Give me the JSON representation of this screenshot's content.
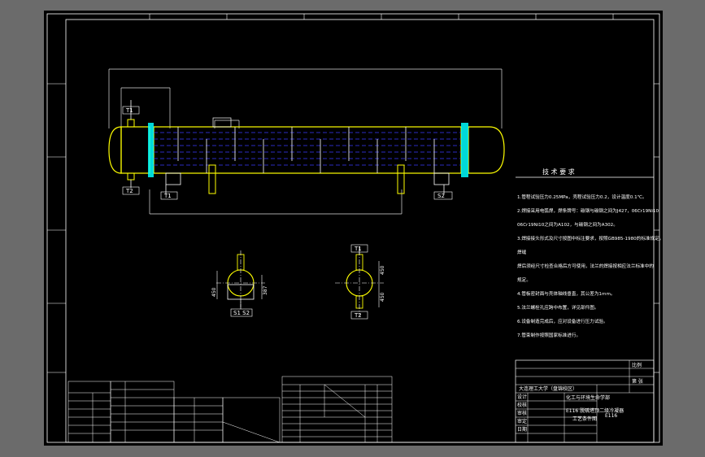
{
  "colors": {
    "background": "#000000",
    "frame": "#ffffff",
    "vessel_outline": "#ffff00",
    "tube_lines": "#3a3aff",
    "flange": "#00ffff",
    "dimension": "#e0e0e0",
    "text": "#ffffff"
  },
  "nozzles": {
    "t1_top": "T1",
    "t2_bottom": "T2",
    "t1_support": "T1",
    "s2": "S2",
    "section_left": "S1 S2",
    "section_right_top": "T1",
    "section_right_bottom": "T2"
  },
  "section_dims": {
    "left_a": "450",
    "left_b": "387",
    "right_a": "450",
    "right_b": "450"
  },
  "tech_requirements": {
    "title": "技 术 要 求",
    "notes": [
      "1.管程试验压力0.25MPa，壳程试验压力0.2，设计温度0.1℃。",
      "2.焊接采用电弧焊，焊条牌号：碳钢与碳钢之间为J427，06Cr19Ni10",
      "  06Cr19Ni10之间为A102，与碳钢之间为A302。",
      "3.焊接接头形式及尺寸按图中标注要求，按照GB985-1980的标准规定。",
      "  焊缝",
      "  焊后须经尺寸检查合格后方可使用，法兰的焊接按相应法兰标准中的",
      "  规定。",
      "4.管板密封面与壳体轴线垂直，其公差为1mm。",
      "5.法兰螺栓孔应跨中布置，详见部件图。",
      "6.设备制造完成后，应对设备进行压力试验。",
      "7.管束制作按照国家标准进行。"
    ]
  },
  "title_block": {
    "school": "大连理工大学（盘锦校区）",
    "drawing_title": "E116 脱硫塔顶二级冷凝器",
    "drawing_subtitle": "工艺条件图",
    "dept": "化工与环境生命学部",
    "scale": "比例",
    "sheet": "第 张",
    "code": "E116",
    "rows": [
      "设计",
      "校核",
      "审核",
      "审定",
      "日期"
    ]
  }
}
